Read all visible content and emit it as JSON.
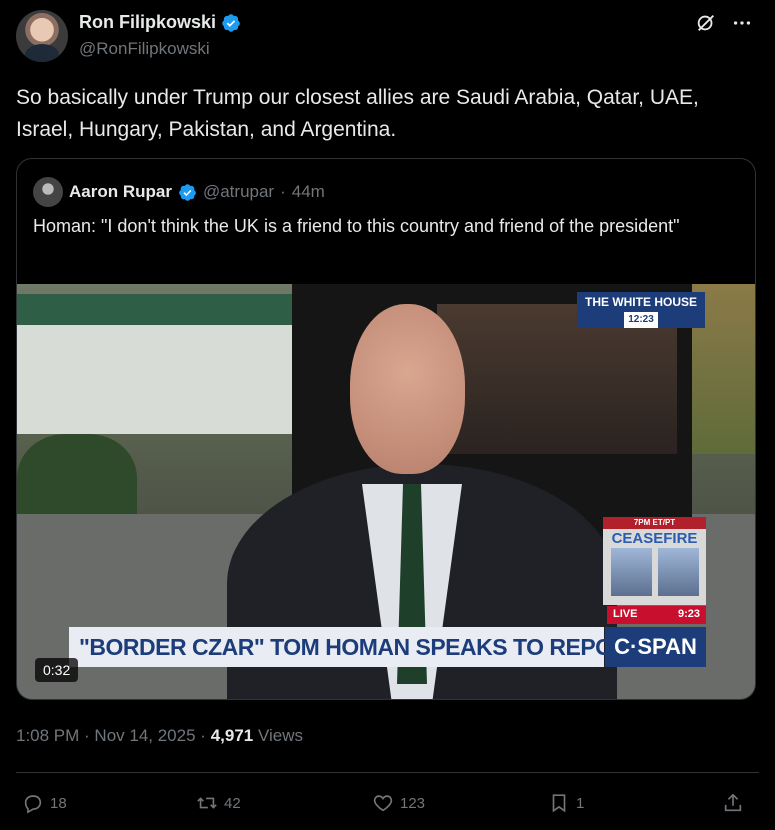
{
  "author": {
    "name": "Ron Filipkowski",
    "handle": "@RonFilipkowski"
  },
  "tweet": {
    "text": "So basically under Trump our closest allies are Saudi Arabia, Qatar, UAE, Israel, Hungary, Pakistan, and Argentina."
  },
  "quoted": {
    "name": "Aaron Rupar",
    "handle": "@atrupar",
    "separator": "·",
    "time": "44m",
    "text": "Homan: \"I don't think the UK is a friend to this country and friend of the president\"",
    "video": {
      "duration": "0:32",
      "location_banner": "THE WHITE HOUSE",
      "clock": "12:23",
      "lower_third": "\"BORDER CZAR\" TOM HOMAN SPEAKS TO REPORTERS",
      "network": "C·SPAN",
      "live_label": "LIVE",
      "live_time": "9:23",
      "ceasefire_top": "7PM ET/PT",
      "ceasefire_title": "CEASEFIRE"
    }
  },
  "meta": {
    "timestamp": "1:08 PM · Nov 14, 2025",
    "separator": "·",
    "views_count": "4,971",
    "views_label": "Views"
  },
  "actions": {
    "replies": "18",
    "reposts": "42",
    "likes": "123",
    "bookmarks": "1"
  },
  "colors": {
    "background": "#000000",
    "text": "#e7e9ea",
    "muted": "#71767b",
    "verified": "#1d9bf0",
    "border": "#2f3336"
  }
}
